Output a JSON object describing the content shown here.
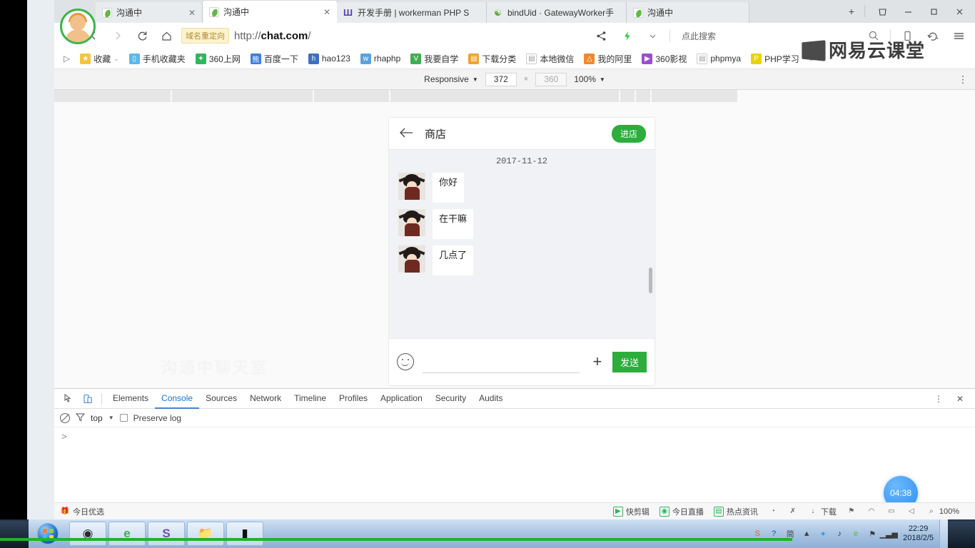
{
  "browser": {
    "tabs": [
      {
        "title": "沟通中",
        "icon": "leaf-icon",
        "active": false,
        "close": "✕"
      },
      {
        "title": "沟通中",
        "icon": "leaf-icon",
        "active": true,
        "close": "✕"
      },
      {
        "title": "开发手册 | workerman PHP S",
        "icon": "w-icon",
        "active": false,
        "close": ""
      },
      {
        "title": "bindUid · GatewayWorker手",
        "icon": "gw-icon",
        "active": false,
        "close": ""
      },
      {
        "title": "沟通中",
        "icon": "leaf-icon",
        "active": false,
        "close": ""
      }
    ],
    "new_tab_label": "+",
    "window_buttons": [
      {
        "name": "skin-button",
        "glyph": "♕"
      },
      {
        "name": "minimize-button",
        "glyph": "—"
      },
      {
        "name": "maximize-button",
        "glyph": "❐"
      },
      {
        "name": "close-button",
        "glyph": "✕"
      }
    ],
    "nav": {
      "back": "‹",
      "forward": "›",
      "reload": "⟳",
      "home": "⌂",
      "redirect_badge": "域名重定向",
      "url_prefix": "http://",
      "url_host": "chat.com",
      "url_suffix": "/",
      "share_icon": "share-icon",
      "lightning_icon": "lightning-icon",
      "chevron_icon": "chevron-down-icon",
      "search_label": "点此搜索",
      "search_icon": "search-icon",
      "mobile_icon": "mobile-icon",
      "history_icon": "history-icon",
      "menu_icon": "hamburger-menu-icon"
    },
    "bookmarks": {
      "overflow_left": "▷",
      "items": [
        {
          "label": "收藏",
          "icon": "star-icon",
          "color": "#f5c342",
          "glyph": "★",
          "caret": "⌄"
        },
        {
          "label": "手机收藏夹",
          "icon": "phone-icon",
          "color": "#5bb8e8",
          "glyph": "▯",
          "caret": ""
        },
        {
          "label": "360上网",
          "icon": "360-icon",
          "color": "#2eb85c",
          "glyph": "✦",
          "caret": ""
        },
        {
          "label": "百度一下",
          "icon": "baidu-icon",
          "color": "#3b7fe0",
          "glyph": "熊",
          "caret": ""
        },
        {
          "label": "hao123",
          "icon": "hao123-icon",
          "color": "#3b6fc4",
          "glyph": "h",
          "caret": ""
        },
        {
          "label": "rhaphp",
          "icon": "rhaphp-icon",
          "color": "#5aa3dd",
          "glyph": "w",
          "caret": ""
        },
        {
          "label": "我要自学",
          "icon": "zixue-icon",
          "color": "#3fae50",
          "glyph": "V",
          "caret": ""
        },
        {
          "label": "下载分类",
          "icon": "download-icon",
          "color": "#f0a32a",
          "glyph": "▤",
          "caret": ""
        },
        {
          "label": "本地微信",
          "icon": "page-icon",
          "color": "#ffffff",
          "glyph": "▤",
          "caret": ""
        },
        {
          "label": "我的阿里",
          "icon": "alibaba-icon",
          "color": "#f1892a",
          "glyph": "△",
          "caret": ""
        },
        {
          "label": "360影视",
          "icon": "video-icon",
          "color": "#9b4fd0",
          "glyph": "▶",
          "caret": ""
        },
        {
          "label": "phpmya",
          "icon": "page-icon",
          "color": "#ffffff",
          "glyph": "▤",
          "caret": ""
        },
        {
          "label": "PHP学习",
          "icon": "php-icon",
          "color": "#e8d400",
          "glyph": "P",
          "caret": ""
        }
      ],
      "overflow_right": "»"
    },
    "device_toolbar": {
      "device": "Responsive",
      "device_caret": "▼",
      "width": "372",
      "x": "×",
      "height": "360",
      "zoom": "100%",
      "zoom_caret": "▼",
      "kebab": "⋮"
    },
    "statusbar": {
      "left_item": {
        "label": "今日优选",
        "icon": "gift-icon"
      },
      "right_items": [
        {
          "label": "快剪辑",
          "icon": "clip-icon",
          "color": "#2eb85c"
        },
        {
          "label": "今日直播",
          "icon": "live-icon",
          "color": "#2eb85c"
        },
        {
          "label": "热点资讯",
          "icon": "news-icon",
          "color": "#2eb85c"
        },
        {
          "label": "",
          "icon": "speed-icon",
          "color": "#666666"
        },
        {
          "label": "",
          "icon": "block-ad-icon",
          "color": "#666666"
        },
        {
          "label": "下载",
          "icon": "download-arrow-icon",
          "color": "#666666"
        },
        {
          "label": "",
          "icon": "flag-icon",
          "color": "#666666"
        },
        {
          "label": "",
          "icon": "mouse-icon",
          "color": "#666666"
        },
        {
          "label": "",
          "icon": "window-icon",
          "color": "#666666"
        },
        {
          "label": "",
          "icon": "sound-icon",
          "color": "#666666"
        },
        {
          "label": "100%",
          "icon": "zoom-icon",
          "color": "#666666"
        }
      ]
    }
  },
  "page": {
    "watermark": "沟通中聊天室",
    "chat": {
      "header": {
        "back_icon": "back-arrow-icon",
        "title": "商店",
        "action_label": "进店"
      },
      "date_divider": "2017-11-12",
      "messages": [
        {
          "side": "left",
          "avatar": "user-avatar",
          "text": "你好"
        },
        {
          "side": "left",
          "avatar": "user-avatar",
          "text": "在干嘛"
        },
        {
          "side": "left",
          "avatar": "user-avatar",
          "text": "几点了"
        }
      ],
      "input": {
        "emoji_icon": "smiley-icon",
        "value": "",
        "placeholder": "",
        "plus_label": "+",
        "send_label": "发送"
      }
    }
  },
  "devtools": {
    "inspect_icon": "inspect-element-icon",
    "device_icon": "device-toolbar-icon",
    "tabs": [
      {
        "label": "Elements",
        "selected": false
      },
      {
        "label": "Console",
        "selected": true
      },
      {
        "label": "Sources",
        "selected": false
      },
      {
        "label": "Network",
        "selected": false
      },
      {
        "label": "Timeline",
        "selected": false
      },
      {
        "label": "Profiles",
        "selected": false
      },
      {
        "label": "Application",
        "selected": false
      },
      {
        "label": "Security",
        "selected": false
      },
      {
        "label": "Audits",
        "selected": false
      }
    ],
    "right_buttons": [
      {
        "name": "devtools-settings-kebab",
        "glyph": "⋮"
      },
      {
        "name": "devtools-close-icon",
        "glyph": "✕"
      }
    ],
    "filterbar": {
      "clear_icon": "clear-console-icon",
      "filter_icon": "filter-icon",
      "context": "top",
      "context_caret": "▼",
      "preserve_log_label": "Preserve log",
      "preserve_log_checked": false
    },
    "console_prompt": ">",
    "recording_timer": "04:38"
  },
  "overlay": {
    "netease_watermark": "网易云课堂"
  },
  "taskbar": {
    "start_label": "Start",
    "buttons": [
      {
        "name": "taskbar-obs",
        "icon": "obs-icon",
        "color": "#2b2b2b"
      },
      {
        "name": "taskbar-browser",
        "icon": "ie-icon",
        "color": "#3fae50"
      },
      {
        "name": "taskbar-phpstorm",
        "icon": "phpstorm-icon",
        "color": "#6c4fa8"
      },
      {
        "name": "taskbar-explorer",
        "icon": "folder-icon",
        "color": "#e8b84a"
      },
      {
        "name": "taskbar-cmd",
        "icon": "cmd-icon",
        "color": "#111111"
      }
    ],
    "tray": [
      {
        "name": "tray-sogou-icon",
        "glyph": "S",
        "color": "#f15a22"
      },
      {
        "name": "tray-help-icon",
        "glyph": "?",
        "color": "#1a56a8"
      },
      {
        "name": "tray-input-icon",
        "glyph": "简",
        "color": "#444444"
      },
      {
        "name": "tray-expand-icon",
        "glyph": "▲",
        "color": "#444444"
      },
      {
        "name": "tray-360-icon",
        "glyph": "✦",
        "color": "#2e9be0"
      },
      {
        "name": "tray-volume-icon",
        "glyph": "♪",
        "color": "#2b2b2b"
      },
      {
        "name": "tray-shield-icon",
        "glyph": "e",
        "color": "#5aba3a"
      },
      {
        "name": "tray-network-icon",
        "glyph": "⚑",
        "color": "#3b3b3b"
      },
      {
        "name": "tray-signal-icon",
        "glyph": "▁▃▅",
        "color": "#3b3b3b"
      }
    ],
    "clock_time": "22:29",
    "clock_date": "2018/2/5"
  }
}
